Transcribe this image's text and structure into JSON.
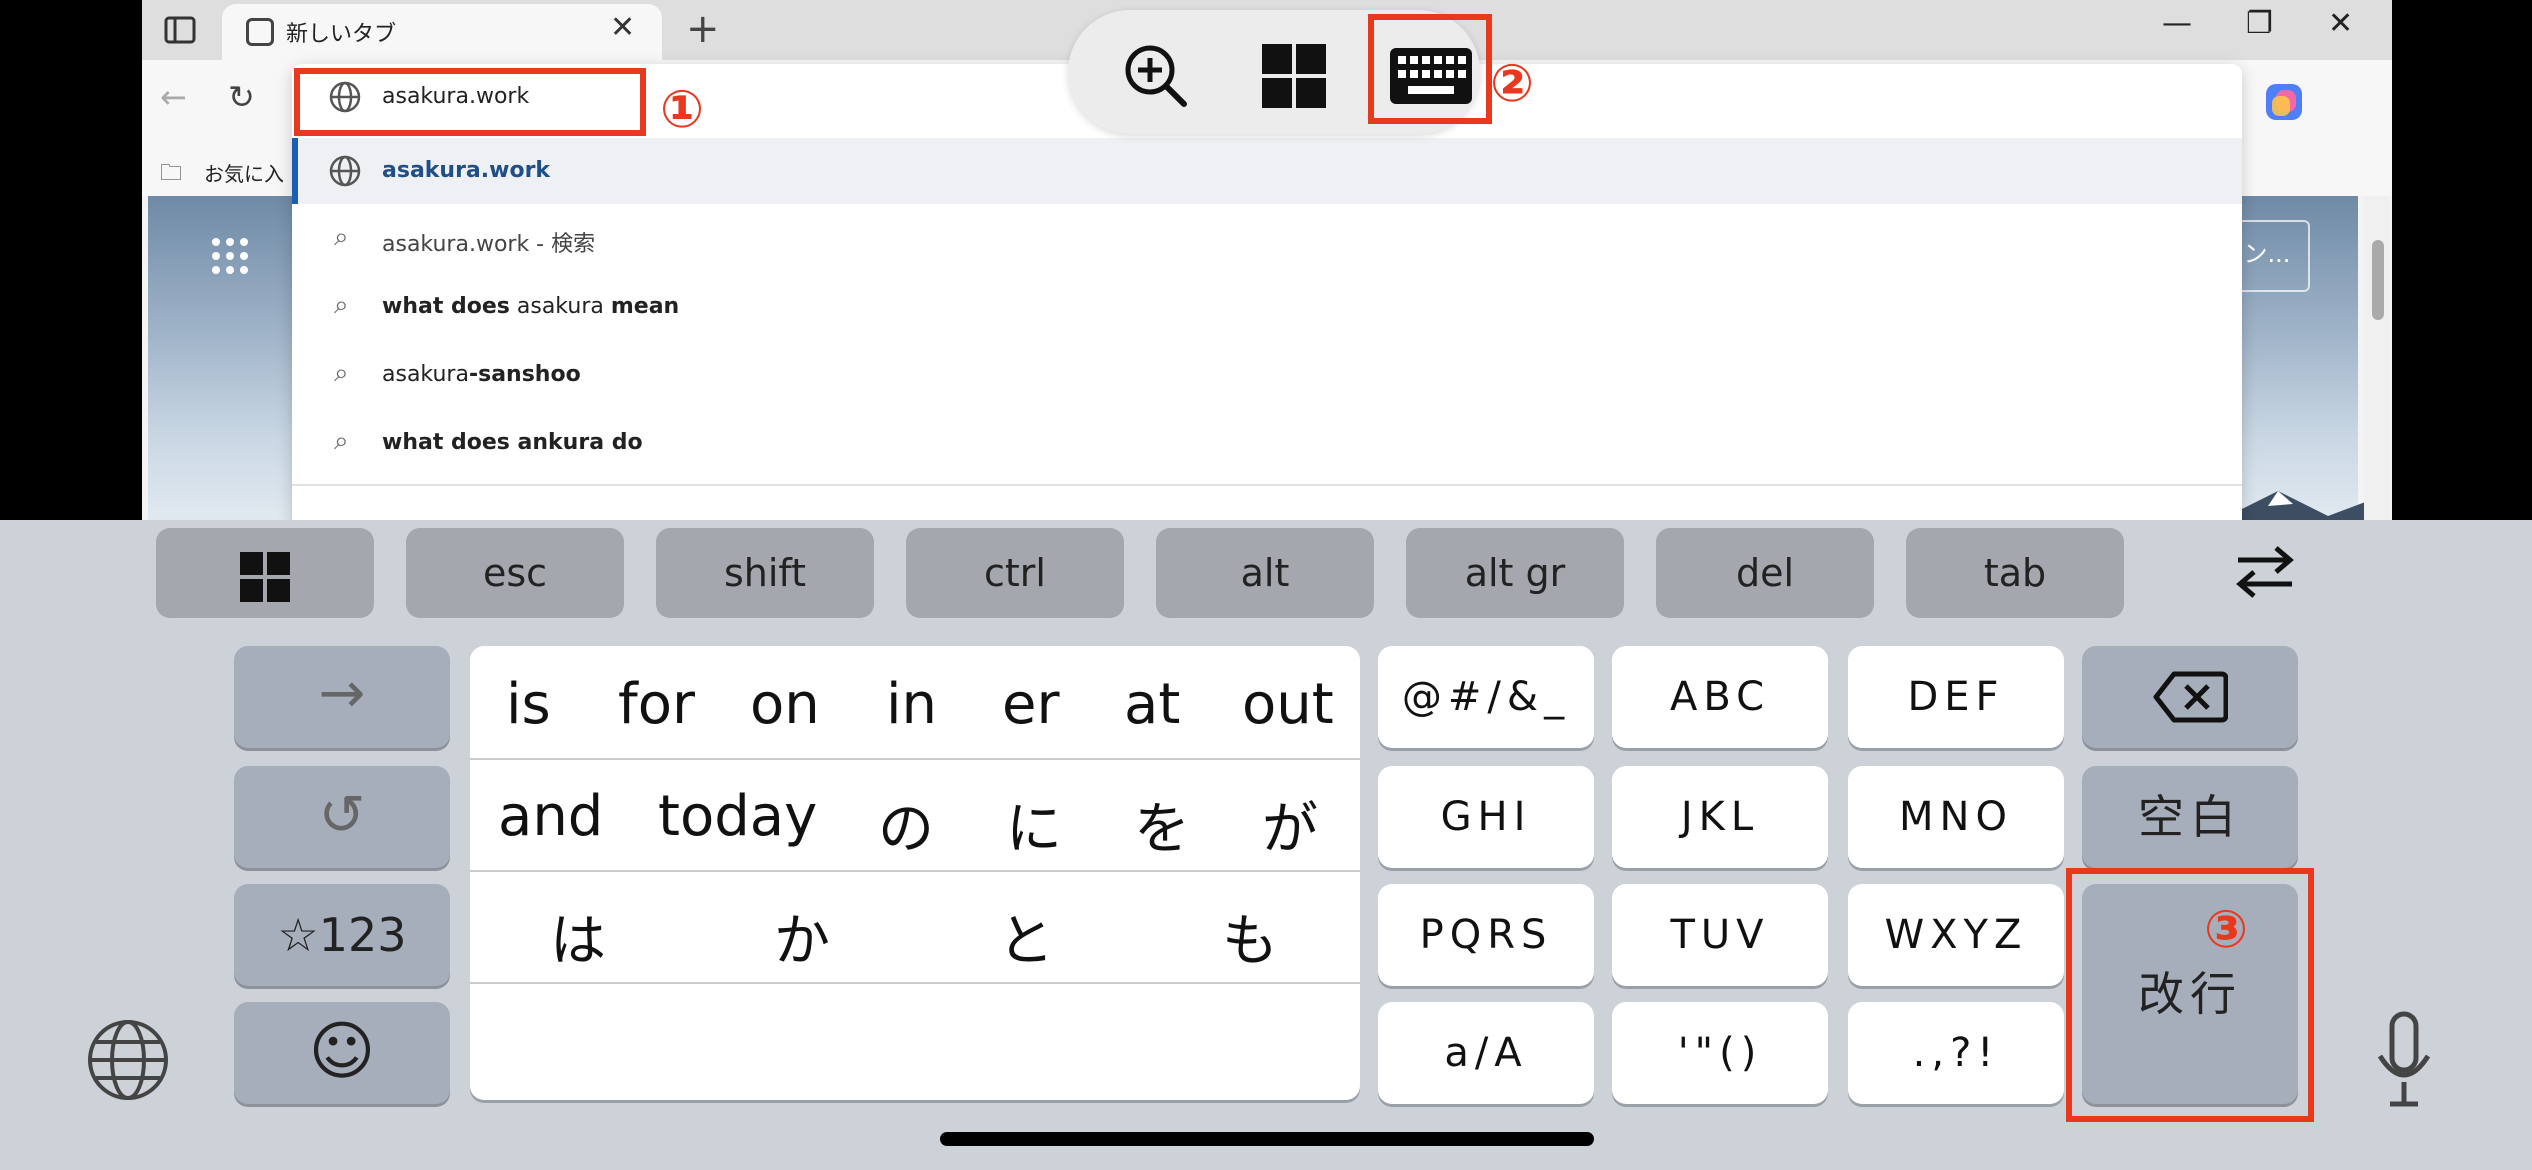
{
  "browser": {
    "tab_title": "新しいタブ",
    "tab_close": "✕",
    "new_tab": "+",
    "minimize": "—",
    "restore": "❐",
    "close": "✕",
    "bookmarks_label": "お気に入",
    "signin_label": "サイン..."
  },
  "address_bar": {
    "value": "asakura.work"
  },
  "suggestions": [
    {
      "icon": "globe-icon",
      "text_bold": "asakura.work",
      "text": ""
    },
    {
      "icon": "search-icon",
      "text": "asakura.work - 検索"
    },
    {
      "icon": "search-icon",
      "text_bold": "what does",
      "text": " asakura ",
      "text_bold2": "mean"
    },
    {
      "icon": "search-icon",
      "text": "asakura",
      "text_bold": "-sanshoo"
    },
    {
      "icon": "search-icon",
      "text_bold": "what does ankura do",
      "text": ""
    }
  ],
  "annotations": {
    "one": "①",
    "two": "②",
    "three": "③"
  },
  "function_keys": [
    "esc",
    "shift",
    "ctrl",
    "alt",
    "alt gr",
    "del",
    "tab"
  ],
  "side_keys": {
    "arrow": "→",
    "undo": "↺",
    "num": "☆123",
    "emoji": "☺"
  },
  "candidates": {
    "row1": [
      "is",
      "for",
      "on",
      "in",
      "er",
      "at",
      "out"
    ],
    "row2": [
      "and",
      "today",
      "の",
      "に",
      "を",
      "が"
    ],
    "row3": [
      "は",
      "か",
      "と",
      "も"
    ]
  },
  "keys": {
    "r1": [
      "@#/&_",
      "ABC",
      "DEF"
    ],
    "r2": [
      "GHI",
      "JKL",
      "MNO"
    ],
    "r3": [
      "PQRS",
      "TUV",
      "WXYZ"
    ],
    "r4": [
      "a/A",
      "'\"()",
      ".,?!"
    ]
  },
  "right_keys": {
    "space": "空白",
    "enter": "改行"
  },
  "colors": {
    "annotation_red": "#e8381e",
    "key_white": "#ffffff",
    "key_gray": "#a7aebb",
    "keyboard_bg": "#cdd1d8"
  }
}
